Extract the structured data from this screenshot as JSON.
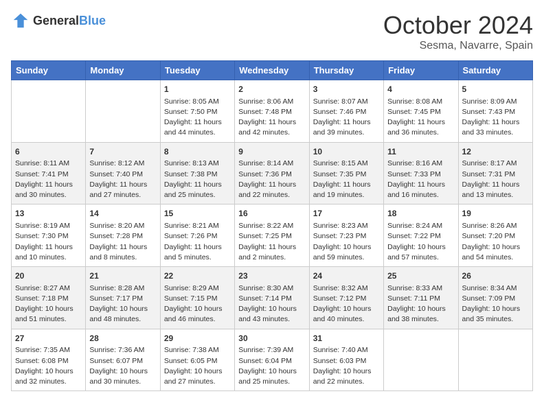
{
  "logo": {
    "general": "General",
    "blue": "Blue"
  },
  "title": "October 2024",
  "location": "Sesma, Navarre, Spain",
  "days_of_week": [
    "Sunday",
    "Monday",
    "Tuesday",
    "Wednesday",
    "Thursday",
    "Friday",
    "Saturday"
  ],
  "weeks": [
    [
      {
        "day": null,
        "content": null
      },
      {
        "day": null,
        "content": null
      },
      {
        "day": "1",
        "sunrise": "Sunrise: 8:05 AM",
        "sunset": "Sunset: 7:50 PM",
        "daylight": "Daylight: 11 hours and 44 minutes."
      },
      {
        "day": "2",
        "sunrise": "Sunrise: 8:06 AM",
        "sunset": "Sunset: 7:48 PM",
        "daylight": "Daylight: 11 hours and 42 minutes."
      },
      {
        "day": "3",
        "sunrise": "Sunrise: 8:07 AM",
        "sunset": "Sunset: 7:46 PM",
        "daylight": "Daylight: 11 hours and 39 minutes."
      },
      {
        "day": "4",
        "sunrise": "Sunrise: 8:08 AM",
        "sunset": "Sunset: 7:45 PM",
        "daylight": "Daylight: 11 hours and 36 minutes."
      },
      {
        "day": "5",
        "sunrise": "Sunrise: 8:09 AM",
        "sunset": "Sunset: 7:43 PM",
        "daylight": "Daylight: 11 hours and 33 minutes."
      }
    ],
    [
      {
        "day": "6",
        "sunrise": "Sunrise: 8:11 AM",
        "sunset": "Sunset: 7:41 PM",
        "daylight": "Daylight: 11 hours and 30 minutes."
      },
      {
        "day": "7",
        "sunrise": "Sunrise: 8:12 AM",
        "sunset": "Sunset: 7:40 PM",
        "daylight": "Daylight: 11 hours and 27 minutes."
      },
      {
        "day": "8",
        "sunrise": "Sunrise: 8:13 AM",
        "sunset": "Sunset: 7:38 PM",
        "daylight": "Daylight: 11 hours and 25 minutes."
      },
      {
        "day": "9",
        "sunrise": "Sunrise: 8:14 AM",
        "sunset": "Sunset: 7:36 PM",
        "daylight": "Daylight: 11 hours and 22 minutes."
      },
      {
        "day": "10",
        "sunrise": "Sunrise: 8:15 AM",
        "sunset": "Sunset: 7:35 PM",
        "daylight": "Daylight: 11 hours and 19 minutes."
      },
      {
        "day": "11",
        "sunrise": "Sunrise: 8:16 AM",
        "sunset": "Sunset: 7:33 PM",
        "daylight": "Daylight: 11 hours and 16 minutes."
      },
      {
        "day": "12",
        "sunrise": "Sunrise: 8:17 AM",
        "sunset": "Sunset: 7:31 PM",
        "daylight": "Daylight: 11 hours and 13 minutes."
      }
    ],
    [
      {
        "day": "13",
        "sunrise": "Sunrise: 8:19 AM",
        "sunset": "Sunset: 7:30 PM",
        "daylight": "Daylight: 11 hours and 10 minutes."
      },
      {
        "day": "14",
        "sunrise": "Sunrise: 8:20 AM",
        "sunset": "Sunset: 7:28 PM",
        "daylight": "Daylight: 11 hours and 8 minutes."
      },
      {
        "day": "15",
        "sunrise": "Sunrise: 8:21 AM",
        "sunset": "Sunset: 7:26 PM",
        "daylight": "Daylight: 11 hours and 5 minutes."
      },
      {
        "day": "16",
        "sunrise": "Sunrise: 8:22 AM",
        "sunset": "Sunset: 7:25 PM",
        "daylight": "Daylight: 11 hours and 2 minutes."
      },
      {
        "day": "17",
        "sunrise": "Sunrise: 8:23 AM",
        "sunset": "Sunset: 7:23 PM",
        "daylight": "Daylight: 10 hours and 59 minutes."
      },
      {
        "day": "18",
        "sunrise": "Sunrise: 8:24 AM",
        "sunset": "Sunset: 7:22 PM",
        "daylight": "Daylight: 10 hours and 57 minutes."
      },
      {
        "day": "19",
        "sunrise": "Sunrise: 8:26 AM",
        "sunset": "Sunset: 7:20 PM",
        "daylight": "Daylight: 10 hours and 54 minutes."
      }
    ],
    [
      {
        "day": "20",
        "sunrise": "Sunrise: 8:27 AM",
        "sunset": "Sunset: 7:18 PM",
        "daylight": "Daylight: 10 hours and 51 minutes."
      },
      {
        "day": "21",
        "sunrise": "Sunrise: 8:28 AM",
        "sunset": "Sunset: 7:17 PM",
        "daylight": "Daylight: 10 hours and 48 minutes."
      },
      {
        "day": "22",
        "sunrise": "Sunrise: 8:29 AM",
        "sunset": "Sunset: 7:15 PM",
        "daylight": "Daylight: 10 hours and 46 minutes."
      },
      {
        "day": "23",
        "sunrise": "Sunrise: 8:30 AM",
        "sunset": "Sunset: 7:14 PM",
        "daylight": "Daylight: 10 hours and 43 minutes."
      },
      {
        "day": "24",
        "sunrise": "Sunrise: 8:32 AM",
        "sunset": "Sunset: 7:12 PM",
        "daylight": "Daylight: 10 hours and 40 minutes."
      },
      {
        "day": "25",
        "sunrise": "Sunrise: 8:33 AM",
        "sunset": "Sunset: 7:11 PM",
        "daylight": "Daylight: 10 hours and 38 minutes."
      },
      {
        "day": "26",
        "sunrise": "Sunrise: 8:34 AM",
        "sunset": "Sunset: 7:09 PM",
        "daylight": "Daylight: 10 hours and 35 minutes."
      }
    ],
    [
      {
        "day": "27",
        "sunrise": "Sunrise: 7:35 AM",
        "sunset": "Sunset: 6:08 PM",
        "daylight": "Daylight: 10 hours and 32 minutes."
      },
      {
        "day": "28",
        "sunrise": "Sunrise: 7:36 AM",
        "sunset": "Sunset: 6:07 PM",
        "daylight": "Daylight: 10 hours and 30 minutes."
      },
      {
        "day": "29",
        "sunrise": "Sunrise: 7:38 AM",
        "sunset": "Sunset: 6:05 PM",
        "daylight": "Daylight: 10 hours and 27 minutes."
      },
      {
        "day": "30",
        "sunrise": "Sunrise: 7:39 AM",
        "sunset": "Sunset: 6:04 PM",
        "daylight": "Daylight: 10 hours and 25 minutes."
      },
      {
        "day": "31",
        "sunrise": "Sunrise: 7:40 AM",
        "sunset": "Sunset: 6:03 PM",
        "daylight": "Daylight: 10 hours and 22 minutes."
      },
      {
        "day": null,
        "content": null
      },
      {
        "day": null,
        "content": null
      }
    ]
  ]
}
